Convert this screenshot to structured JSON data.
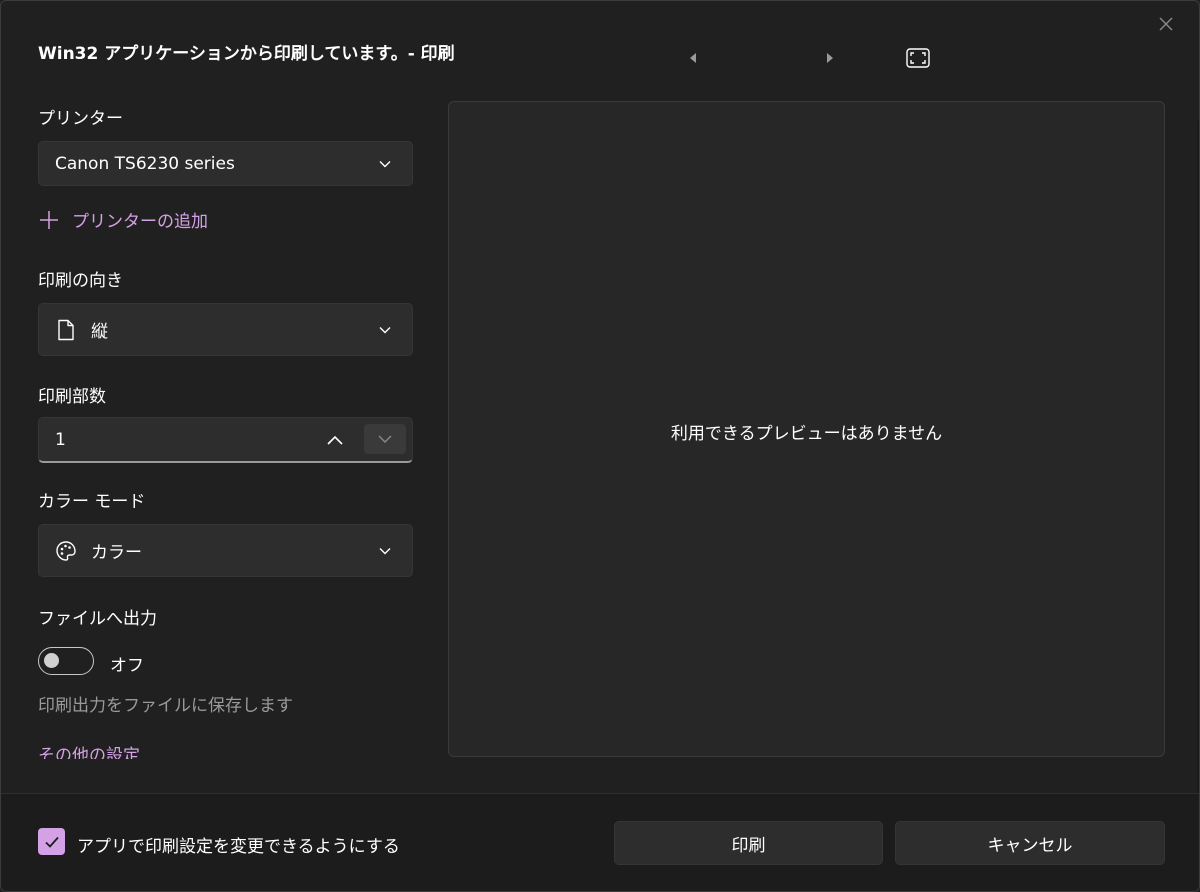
{
  "dialog": {
    "title": "Win32 アプリケーションから印刷しています。- 印刷"
  },
  "icons": {
    "close": "close-icon",
    "prev": "caret-left-icon",
    "next": "caret-right-icon",
    "fit": "fit-to-page-icon"
  },
  "printer": {
    "label": "プリンター",
    "selected": "Canon TS6230 series",
    "add_link": "プリンターの追加"
  },
  "orientation": {
    "label": "印刷の向き",
    "selected": "縦"
  },
  "copies": {
    "label": "印刷部数",
    "value": "1"
  },
  "color_mode": {
    "label": "カラー モード",
    "selected": "カラー"
  },
  "print_to_file": {
    "label": "ファイルへ出力",
    "state": "オフ",
    "helper": "印刷出力をファイルに保存します"
  },
  "more_settings": "その他の設定",
  "preview": {
    "message": "利用できるプレビューはありません"
  },
  "footer": {
    "checkbox_label": "アプリで印刷設定を変更できるようにする",
    "checked": true,
    "print_button": "印刷",
    "cancel_button": "キャンセル"
  },
  "colors": {
    "accent": "#d5a1e6",
    "background": "#202020",
    "control": "#2d2d2d"
  }
}
